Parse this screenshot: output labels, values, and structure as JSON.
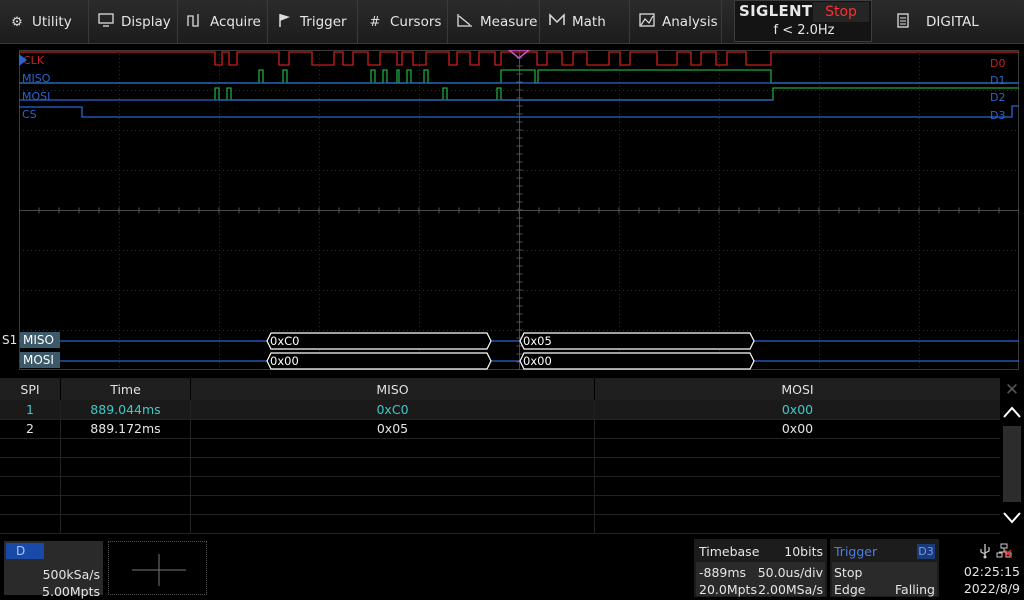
{
  "menu": {
    "items": [
      {
        "id": "utility",
        "label": "Utility",
        "icon": "gear-icon"
      },
      {
        "id": "display",
        "label": "Display",
        "icon": "monitor-icon"
      },
      {
        "id": "acquire",
        "label": "Acquire",
        "icon": "acquire-icon"
      },
      {
        "id": "trigger",
        "label": "Trigger",
        "icon": "flag-icon"
      },
      {
        "id": "cursors",
        "label": "Cursors",
        "icon": "cursor-hash-icon"
      },
      {
        "id": "measure",
        "label": "Measure",
        "icon": "measure-icon"
      },
      {
        "id": "math",
        "label": "Math",
        "icon": "math-icon"
      },
      {
        "id": "analysis",
        "label": "Analysis",
        "icon": "analysis-icon"
      }
    ],
    "digital_label": "DIGITAL",
    "digital_icon": "digital-doc-icon"
  },
  "brand": {
    "name": "SIGLENT",
    "run_state": "Stop",
    "run_state_color": "#ff3030",
    "trigger_freq": "f < 2.0Hz"
  },
  "waveform": {
    "channels": [
      {
        "name": "CLK",
        "tag": "D0",
        "color": "#c81e1e"
      },
      {
        "name": "MISO",
        "tag": "D1",
        "color": "#2a64d0"
      },
      {
        "name": "MOSI",
        "tag": "D2",
        "color": "#1ea83c"
      },
      {
        "name": "CS",
        "tag": "D3",
        "color": "#2a64d0"
      }
    ],
    "bus": {
      "id": "S1",
      "lines": [
        {
          "name": "MISO",
          "packets": [
            "0xC0",
            "0x05"
          ]
        },
        {
          "name": "MOSI",
          "packets": [
            "0x00",
            "0x00"
          ]
        }
      ]
    }
  },
  "decode_table": {
    "headers": [
      "SPI",
      "Time",
      "MISO",
      "MOSI"
    ],
    "rows": [
      {
        "index": "1",
        "time": "889.044ms",
        "miso": "0xC0",
        "mosi": "0x00",
        "selected": true
      },
      {
        "index": "2",
        "time": "889.172ms",
        "miso": "0x05",
        "mosi": "0x00",
        "selected": false
      }
    ]
  },
  "status": {
    "digital_channel": {
      "badge": "D",
      "sample_rate": "500kSa/s",
      "memory_depth": "5.00Mpts"
    },
    "timebase": {
      "title": "Timebase",
      "bits": "10bits",
      "delay": "-889ms",
      "scale": "50.0us/div",
      "points": "20.0Mpts",
      "rate": "2.00MSa/s"
    },
    "trigger": {
      "title": "Trigger",
      "source": "D3",
      "mode": "Stop",
      "type": "Edge",
      "slope": "Falling"
    },
    "clock": {
      "time": "02:25:15",
      "date": "2022/8/9"
    },
    "icons": [
      "usb-icon",
      "network-icon"
    ]
  }
}
